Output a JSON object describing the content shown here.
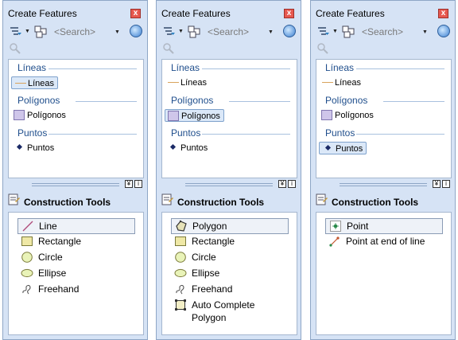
{
  "window_title": "Create Features",
  "close_glyph": "x",
  "search_placeholder": "<Search>",
  "panels": [
    {
      "selected_template": 0,
      "groups": [
        "Líneas",
        "Polígonos",
        "Puntos"
      ],
      "templates": [
        "Líneas",
        "Polígonos",
        "Puntos"
      ],
      "construction_title": "Construction Tools",
      "tools": [
        {
          "label": "Line",
          "icon": "line-icon",
          "selected": true
        },
        {
          "label": "Rectangle",
          "icon": "rectangle-icon"
        },
        {
          "label": "Circle",
          "icon": "circle-icon"
        },
        {
          "label": "Ellipse",
          "icon": "ellipse-icon"
        },
        {
          "label": "Freehand",
          "icon": "freehand-icon"
        }
      ]
    },
    {
      "selected_template": 1,
      "groups": [
        "Líneas",
        "Polígonos",
        "Puntos"
      ],
      "templates": [
        "Líneas",
        "Polígonos",
        "Puntos"
      ],
      "construction_title": "Construction Tools",
      "tools": [
        {
          "label": "Polygon",
          "icon": "polygon-icon",
          "selected": true
        },
        {
          "label": "Rectangle",
          "icon": "rectangle-icon"
        },
        {
          "label": "Circle",
          "icon": "circle-icon"
        },
        {
          "label": "Ellipse",
          "icon": "ellipse-icon"
        },
        {
          "label": "Freehand",
          "icon": "freehand-icon"
        },
        {
          "label": "Auto Complete\nPolygon",
          "icon": "auto-complete-polygon-icon"
        }
      ]
    },
    {
      "selected_template": 2,
      "groups": [
        "Líneas",
        "Polígonos",
        "Puntos"
      ],
      "templates": [
        "Líneas",
        "Polígonos",
        "Puntos"
      ],
      "construction_title": "Construction Tools",
      "tools": [
        {
          "label": "Point",
          "icon": "point-icon",
          "selected": true
        },
        {
          "label": "Point at end of line",
          "icon": "point-at-end-of-line-icon"
        }
      ]
    }
  ]
}
